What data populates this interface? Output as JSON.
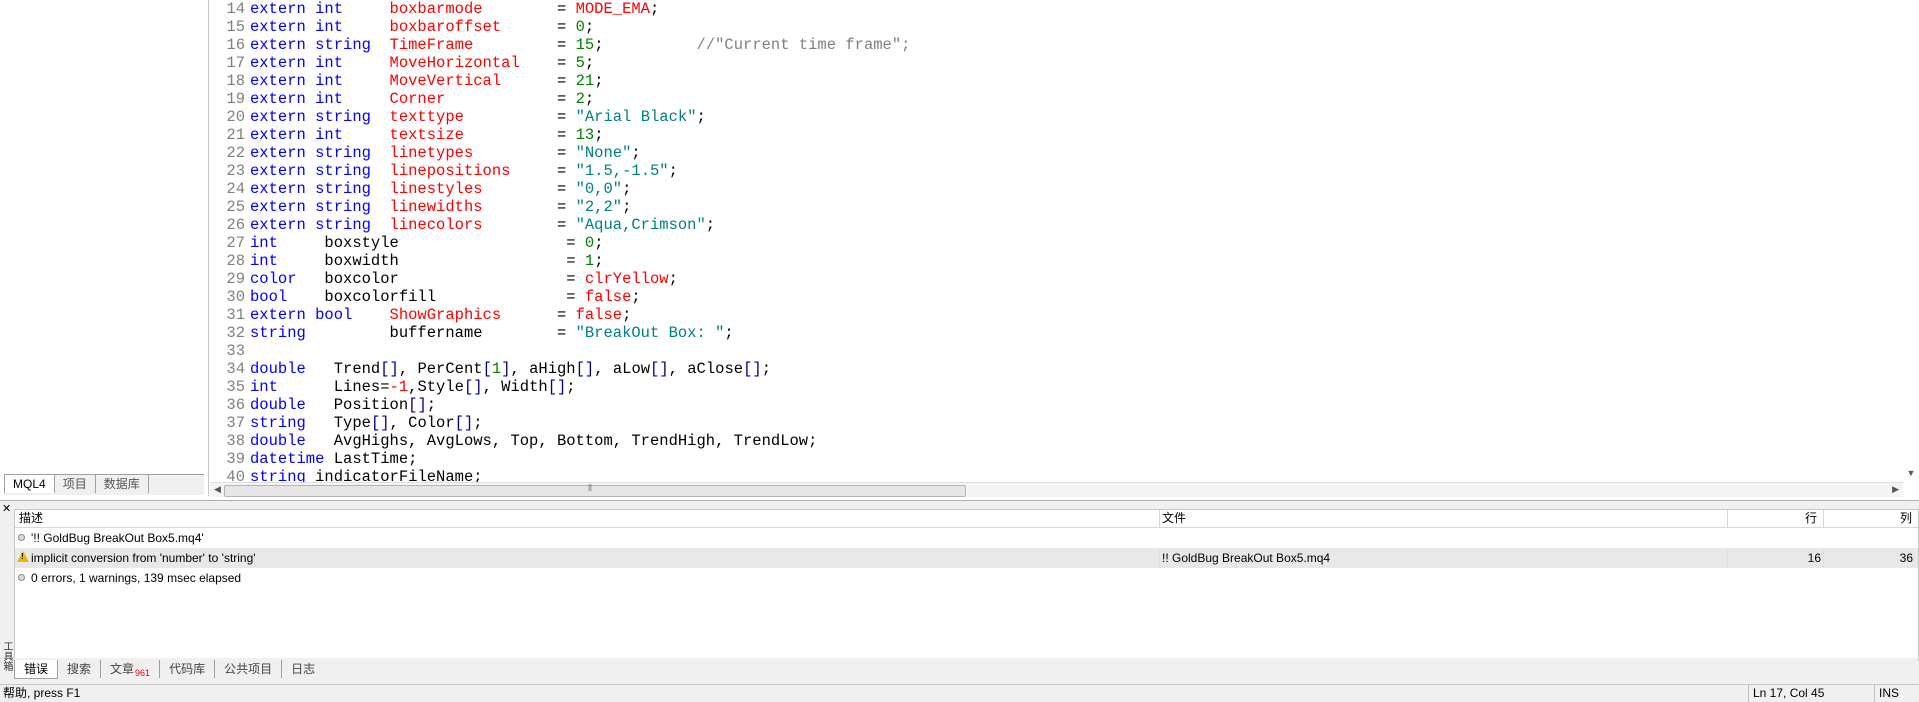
{
  "navigator": {
    "tabs": [
      {
        "label": "MQL4",
        "active": true
      },
      {
        "label": "项目",
        "active": false
      },
      {
        "label": "数据库",
        "active": false
      }
    ]
  },
  "editor": {
    "lines": [
      {
        "num": "14",
        "tokens": [
          [
            "k",
            "extern int     "
          ],
          [
            "v",
            "boxbarmode"
          ],
          [
            "p",
            "        = "
          ],
          [
            "v",
            "MODE_EMA"
          ],
          [
            "p",
            ";"
          ]
        ]
      },
      {
        "num": "15",
        "tokens": [
          [
            "k",
            "extern int     "
          ],
          [
            "v",
            "boxbaroffset"
          ],
          [
            "p",
            "      = "
          ],
          [
            "n",
            "0"
          ],
          [
            "p",
            ";"
          ]
        ]
      },
      {
        "num": "16",
        "tokens": [
          [
            "k",
            "extern string  "
          ],
          [
            "v",
            "TimeFrame"
          ],
          [
            "p",
            "         = "
          ],
          [
            "n",
            "15"
          ],
          [
            "p",
            ";"
          ],
          [
            "c",
            "          //\"Current time frame\";"
          ]
        ]
      },
      {
        "num": "17",
        "tokens": [
          [
            "k",
            "extern int     "
          ],
          [
            "v",
            "MoveHorizontal"
          ],
          [
            "p",
            "    = "
          ],
          [
            "n",
            "5"
          ],
          [
            "p",
            ";"
          ]
        ]
      },
      {
        "num": "18",
        "tokens": [
          [
            "k",
            "extern int     "
          ],
          [
            "v",
            "MoveVertical"
          ],
          [
            "p",
            "      = "
          ],
          [
            "n",
            "21"
          ],
          [
            "p",
            ";"
          ]
        ]
      },
      {
        "num": "19",
        "tokens": [
          [
            "k",
            "extern int     "
          ],
          [
            "v",
            "Corner"
          ],
          [
            "p",
            "            = "
          ],
          [
            "n",
            "2"
          ],
          [
            "p",
            ";"
          ]
        ]
      },
      {
        "num": "20",
        "tokens": [
          [
            "k",
            "extern string  "
          ],
          [
            "v",
            "texttype"
          ],
          [
            "p",
            "          = "
          ],
          [
            "s",
            "\"Arial Black\""
          ],
          [
            "p",
            ";"
          ]
        ]
      },
      {
        "num": "21",
        "tokens": [
          [
            "k",
            "extern int     "
          ],
          [
            "v",
            "textsize"
          ],
          [
            "p",
            "          = "
          ],
          [
            "n",
            "13"
          ],
          [
            "p",
            ";"
          ]
        ]
      },
      {
        "num": "22",
        "tokens": [
          [
            "k",
            "extern string  "
          ],
          [
            "v",
            "linetypes"
          ],
          [
            "p",
            "         = "
          ],
          [
            "s",
            "\"None\""
          ],
          [
            "p",
            ";"
          ]
        ]
      },
      {
        "num": "23",
        "tokens": [
          [
            "k",
            "extern string  "
          ],
          [
            "v",
            "linepositions"
          ],
          [
            "p",
            "     = "
          ],
          [
            "s",
            "\"1.5,-1.5\""
          ],
          [
            "p",
            ";"
          ]
        ]
      },
      {
        "num": "24",
        "tokens": [
          [
            "k",
            "extern string  "
          ],
          [
            "v",
            "linestyles"
          ],
          [
            "p",
            "        = "
          ],
          [
            "s",
            "\"0,0\""
          ],
          [
            "p",
            ";"
          ]
        ]
      },
      {
        "num": "25",
        "tokens": [
          [
            "k",
            "extern string  "
          ],
          [
            "v",
            "linewidths"
          ],
          [
            "p",
            "        = "
          ],
          [
            "s",
            "\"2,2\""
          ],
          [
            "p",
            ";"
          ]
        ]
      },
      {
        "num": "26",
        "tokens": [
          [
            "k",
            "extern string  "
          ],
          [
            "v",
            "linecolors"
          ],
          [
            "p",
            "        = "
          ],
          [
            "s",
            "\"Aqua,Crimson\""
          ],
          [
            "p",
            ";"
          ]
        ]
      },
      {
        "num": "27",
        "tokens": [
          [
            "k",
            "int     "
          ],
          [
            "p",
            "boxstyle                  = "
          ],
          [
            "n",
            "0"
          ],
          [
            "p",
            ";"
          ]
        ]
      },
      {
        "num": "28",
        "tokens": [
          [
            "k",
            "int     "
          ],
          [
            "p",
            "boxwidth                  = "
          ],
          [
            "n",
            "1"
          ],
          [
            "p",
            ";"
          ]
        ]
      },
      {
        "num": "29",
        "tokens": [
          [
            "k",
            "color   "
          ],
          [
            "p",
            "boxcolor                  = "
          ],
          [
            "v",
            "clrYellow"
          ],
          [
            "p",
            ";"
          ]
        ]
      },
      {
        "num": "30",
        "tokens": [
          [
            "k",
            "bool    "
          ],
          [
            "p",
            "boxcolorfill              = "
          ],
          [
            "v",
            "false"
          ],
          [
            "p",
            ";"
          ]
        ]
      },
      {
        "num": "31",
        "tokens": [
          [
            "k",
            "extern bool    "
          ],
          [
            "v",
            "ShowGraphics"
          ],
          [
            "p",
            "      = "
          ],
          [
            "v",
            "false"
          ],
          [
            "p",
            ";"
          ]
        ]
      },
      {
        "num": "32",
        "tokens": [
          [
            "k",
            "string         "
          ],
          [
            "p",
            "buffername        = "
          ],
          [
            "s",
            "\"BreakOut Box: \""
          ],
          [
            "p",
            ";"
          ]
        ]
      },
      {
        "num": "33",
        "tokens": []
      },
      {
        "num": "34",
        "tokens": [
          [
            "k",
            "double   "
          ],
          [
            "p",
            "Trend"
          ],
          [
            "b",
            "[]"
          ],
          [
            "p",
            ", PerCent"
          ],
          [
            "b",
            "["
          ],
          [
            "n",
            "1"
          ],
          [
            "b",
            "]"
          ],
          [
            "p",
            ", aHigh"
          ],
          [
            "b",
            "[]"
          ],
          [
            "p",
            ", aLow"
          ],
          [
            "b",
            "[]"
          ],
          [
            "p",
            ", aClose"
          ],
          [
            "b",
            "[]"
          ],
          [
            "p",
            ";"
          ]
        ]
      },
      {
        "num": "35",
        "tokens": [
          [
            "k",
            "int      "
          ],
          [
            "p",
            "Lines="
          ],
          [
            "v",
            "-1"
          ],
          [
            "p",
            ",Style"
          ],
          [
            "b",
            "[]"
          ],
          [
            "p",
            ", Width"
          ],
          [
            "b",
            "[]"
          ],
          [
            "p",
            ";"
          ]
        ]
      },
      {
        "num": "36",
        "tokens": [
          [
            "k",
            "double   "
          ],
          [
            "p",
            "Position"
          ],
          [
            "b",
            "[]"
          ],
          [
            "p",
            ";"
          ]
        ]
      },
      {
        "num": "37",
        "tokens": [
          [
            "k",
            "string   "
          ],
          [
            "p",
            "Type"
          ],
          [
            "b",
            "[]"
          ],
          [
            "p",
            ", Color"
          ],
          [
            "b",
            "[]"
          ],
          [
            "p",
            ";"
          ]
        ]
      },
      {
        "num": "38",
        "tokens": [
          [
            "k",
            "double   "
          ],
          [
            "p",
            "AvgHighs, AvgLows, Top, Bottom, TrendHigh, TrendLow;"
          ]
        ]
      },
      {
        "num": "39",
        "tokens": [
          [
            "k",
            "datetime "
          ],
          [
            "p",
            "LastTime;"
          ]
        ]
      },
      {
        "num": "40",
        "tokens": [
          [
            "k",
            "string "
          ],
          [
            "p",
            "indicatorFileName;"
          ]
        ]
      }
    ]
  },
  "toolbox": {
    "vertical_label": "工具箱",
    "columns": {
      "desc": "描述",
      "file": "文件",
      "line": "行",
      "col": "列"
    },
    "rows": [
      {
        "type": "info",
        "desc": "'!! GoldBug BreakOut Box5.mq4'",
        "file": "",
        "line": "",
        "col": ""
      },
      {
        "type": "warning",
        "desc": "implicit conversion from 'number' to 'string'",
        "file": "!! GoldBug BreakOut Box5.mq4",
        "line": "16",
        "col": "36"
      },
      {
        "type": "info",
        "desc": "0 errors, 1 warnings, 139 msec elapsed",
        "file": "",
        "line": "",
        "col": ""
      }
    ],
    "tabs": [
      {
        "label": "错误",
        "active": true,
        "badge": ""
      },
      {
        "label": "搜索",
        "active": false,
        "badge": ""
      },
      {
        "label": "文章",
        "active": false,
        "badge": "961"
      },
      {
        "label": "代码库",
        "active": false,
        "badge": ""
      },
      {
        "label": "公共项目",
        "active": false,
        "badge": ""
      },
      {
        "label": "日志",
        "active": false,
        "badge": ""
      }
    ]
  },
  "statusbar": {
    "help": "帮助, press F1",
    "position": "Ln 17, Col 45",
    "mode": "INS"
  }
}
